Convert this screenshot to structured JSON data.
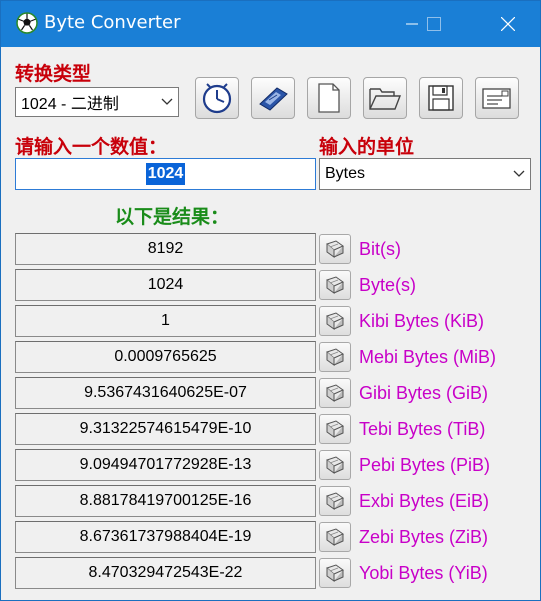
{
  "window": {
    "title": "Byte Converter"
  },
  "controls": {
    "conversion_type_label": "转换类型",
    "conversion_type_value": "1024 - 二进制",
    "input_value_label": "请输入一个数值：",
    "input_value": "1024",
    "input_unit_label": "输入的单位",
    "input_unit_value": "Bytes",
    "results_label": "以下是结果："
  },
  "toolbar": [
    {
      "icon": "clock-icon"
    },
    {
      "icon": "calculator-icon"
    },
    {
      "icon": "new-document-icon"
    },
    {
      "icon": "open-folder-icon"
    },
    {
      "icon": "save-disk-icon"
    },
    {
      "icon": "about-card-icon"
    }
  ],
  "results": [
    {
      "value": "8192",
      "unit": "Bit(s)"
    },
    {
      "value": "1024",
      "unit": "Byte(s)"
    },
    {
      "value": "1",
      "unit": "Kibi Bytes (KiB)"
    },
    {
      "value": "0.0009765625",
      "unit": "Mebi Bytes (MiB)"
    },
    {
      "value": "9.5367431640625E-07",
      "unit": "Gibi Bytes (GiB)"
    },
    {
      "value": "9.31322574615479E-10",
      "unit": "Tebi Bytes (TiB)"
    },
    {
      "value": "9.09494701772928E-13",
      "unit": "Pebi Bytes (PiB)"
    },
    {
      "value": "8.88178419700125E-16",
      "unit": "Exbi Bytes (EiB)"
    },
    {
      "value": "8.67361737988404E-19",
      "unit": "Zebi Bytes (ZiB)"
    },
    {
      "value": "8.470329472543E-22",
      "unit": "Yobi Bytes (YiB)"
    }
  ],
  "colors": {
    "titlebar": "#1a7fd6",
    "label_red": "#c8000a",
    "label_green": "#1a8c1a",
    "unit_magenta": "#c800c8",
    "selection": "#0a64d8"
  }
}
